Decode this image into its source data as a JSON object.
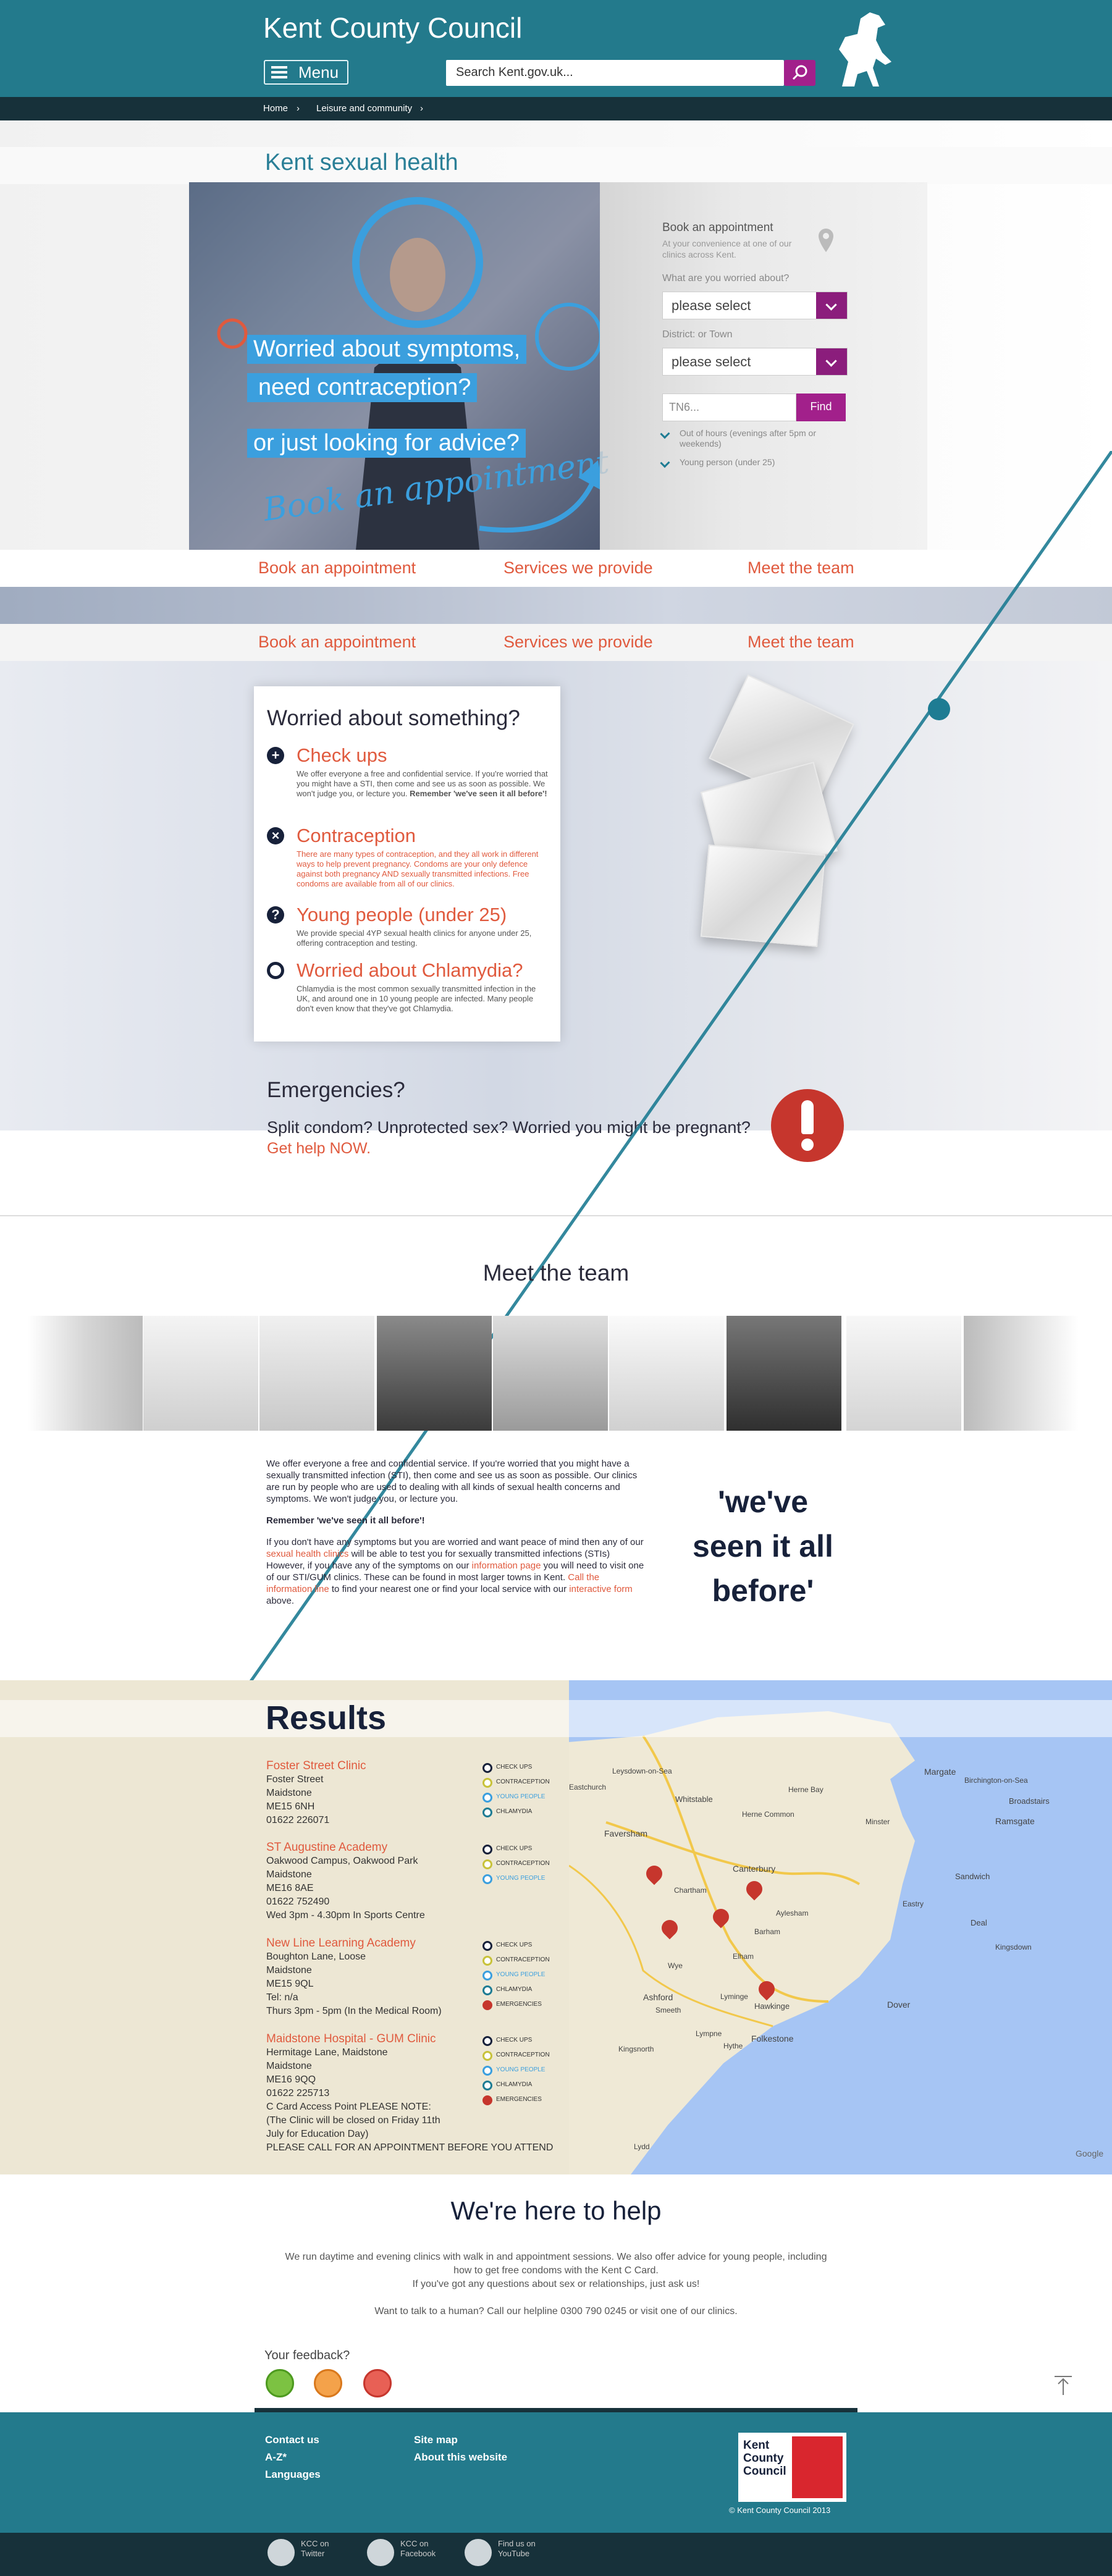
{
  "header": {
    "brand": "Kent County Council",
    "menu_label": "Menu",
    "search_placeholder": "Search Kent.gov.uk..."
  },
  "breadcrumb": [
    "Home",
    "Leisure and community"
  ],
  "hero": {
    "title": "Kent sexual health",
    "line1": "Worried about symptoms,",
    "line2": "need contraception?",
    "line3": "or just looking for advice?",
    "script": "Book an appointment"
  },
  "booking": {
    "title": "Book an appointment",
    "subtitle": "At your convenience at one of our clinics across Kent.",
    "worried_label": "What are you worried about?",
    "worried_value": "please select",
    "district_label": "District: or Town",
    "district_value": "please select",
    "postcode_placeholder": "TN6...",
    "find_label": "Find",
    "opt_out_of_hours": "Out of hours (evenings after 5pm or weekends)",
    "opt_young": "Young person (under 25)"
  },
  "nav": [
    "Book an appointment",
    "Services we provide",
    "Meet the team"
  ],
  "worried": {
    "title": "Worried about something?",
    "items": [
      {
        "title": "Check ups",
        "text": "We offer everyone a free and confidential service. If you're worried that you might have a STI, then come and see us as soon as possible. We won't judge you, or lecture you.",
        "bold": "Remember 'we've seen it all before'!"
      },
      {
        "title": "Contraception",
        "text": "There are many types of contraception, and they all work in different ways to help prevent pregnancy. Condoms are your only defence against both pregnancy AND sexually transmitted infections. Free condoms are available from all of our clinics."
      },
      {
        "title": "Young people (under 25)",
        "text": "We provide special 4YP sexual health clinics for anyone under 25, offering contraception and testing."
      },
      {
        "title": "Worried about Chlamydia?",
        "text": "Chlamydia is the most common sexually transmitted infection in the UK, and around one in 10 young people are infected. Many people don't even know that they've got Chlamydia."
      }
    ]
  },
  "emergencies": {
    "title": "Emergencies?",
    "text": "Split condom? Unprotected sex? Worried you might be pregnant?",
    "link": "Get help NOW."
  },
  "team": {
    "title": "Meet the team",
    "p1": "We offer everyone a free and confidential service. If you're worried that you might have a sexually transmitted infection (STI), then come and see us as soon as possible. Our clinics are run by people who are used to dealing with all kinds of sexual health concerns and symptoms. We won't judge you, or lecture you.",
    "p2": "Remember 'we've seen it all before'!",
    "p3a": "If you don't have any symptoms but you are worried and want peace of mind then any of our",
    "p3_link1": "sexual health clinics",
    "p3b": "will be able to test you for sexually transmitted infections (STIs) However, if you have any of the symptoms on our",
    "p3_link2": "information page",
    "p3c": "you will need to visit one of our STI/GUM clinics. These can be found in most larger towns in Kent.",
    "p3_link3": "Call the information line",
    "p3d": "to find your nearest one or find your local service with our",
    "p3_link4": "interactive form",
    "p3e": "above.",
    "quote": "'we've seen it all before'"
  },
  "results": {
    "title": "Results",
    "clinics": [
      {
        "name": "Foster Street Clinic",
        "lines": [
          "Foster Street",
          "Maidstone",
          "ME15 6NH",
          "01622 226071"
        ],
        "tags": [
          "CHECK UPS",
          "CONTRACEPTION",
          "YOUNG PEOPLE",
          "CHLAMYDIA"
        ]
      },
      {
        "name": "ST Augustine Academy",
        "lines": [
          "Oakwood Campus, Oakwood Park",
          "Maidstone",
          "ME16 8AE",
          "01622 752490",
          "Wed 3pm - 4.30pm In Sports Centre"
        ],
        "tags": [
          "CHECK UPS",
          "CONTRACEPTION",
          "YOUNG PEOPLE"
        ]
      },
      {
        "name": "New Line Learning Academy",
        "lines": [
          "Boughton Lane, Loose",
          "Maidstone",
          "ME15 9QL",
          "Tel: n/a",
          "Thurs 3pm - 5pm (In the Medical Room)"
        ],
        "tags": [
          "CHECK UPS",
          "CONTRACEPTION",
          "YOUNG PEOPLE",
          "CHLAMYDIA",
          "EMERGENCIES"
        ]
      },
      {
        "name": "Maidstone Hospital - GUM Clinic",
        "lines": [
          "Hermitage Lane, Maidstone",
          "Maidstone",
          "ME16 9QQ",
          "01622 225713",
          "C Card Access Point PLEASE NOTE:",
          "(The Clinic will be closed on Friday 11th",
          "July for Education Day)",
          "PLEASE CALL FOR AN APPOINTMENT BEFORE YOU ATTEND"
        ],
        "tags": [
          "CHECK UPS",
          "CONTRACEPTION",
          "YOUNG PEOPLE",
          "CHLAMYDIA",
          "EMERGENCIES"
        ]
      }
    ],
    "map_labels": [
      "Margate",
      "Herne Bay",
      "Whitstable",
      "Birchington-on-Sea",
      "Broadstairs",
      "Ramsgate",
      "Faversham",
      "Canterbury",
      "Sandwich",
      "Deal",
      "Chartham",
      "Aylesham",
      "Barham",
      "Ashford",
      "Hawkinge",
      "Folkestone",
      "Dover",
      "Lydd",
      "Lympne",
      "Hythe",
      "Leysdown-on-Sea",
      "Eastchurch",
      "Minster",
      "Elham",
      "Kingsdown",
      "Lyminge",
      "Kingsnorth",
      "Smeeth",
      "Wye",
      "Eastry",
      "Herne Common",
      "Google"
    ]
  },
  "help": {
    "title": "We're here to help",
    "line1": "We run daytime and evening clinics with walk in and appointment sessions. We also offer advice for young people, including",
    "line2": "how to get free condoms with the Kent C Card.",
    "line3": "If you've got any questions about sex or relationships, just ask us!",
    "line4": "Want to talk to a human? Call our helpline 0300 790 0245 or visit one of our clinics.",
    "feedback": "Your feedback?"
  },
  "footer": {
    "links_col1": [
      "Contact us",
      "A-Z*",
      "Languages"
    ],
    "links_col2": [
      "Site map",
      "About this website"
    ],
    "logo_text": "Kent County Council",
    "copyright": "© Kent County Council 2013",
    "social": [
      {
        "line1": "KCC on",
        "line2": "Twitter"
      },
      {
        "line1": "KCC on",
        "line2": "Facebook"
      },
      {
        "line1": "Find us on",
        "line2": "YouTube"
      }
    ]
  },
  "colors": {
    "header_teal": "#237a8c",
    "dark_navy": "#17313a",
    "accent_orange": "#e05a3e",
    "accent_purple": "#a2208b",
    "hero_blue": "#3b9fde"
  }
}
